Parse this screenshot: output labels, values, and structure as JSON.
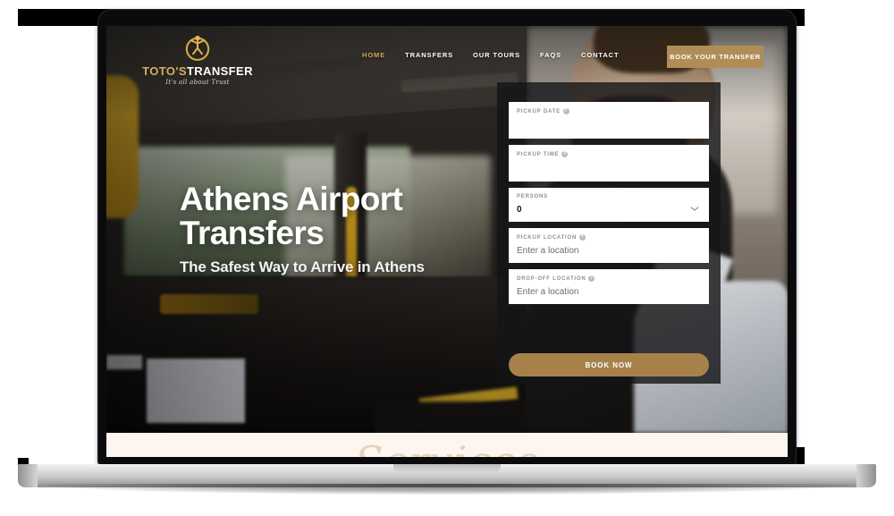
{
  "site": {
    "brand": {
      "name_part1": "TOTO'S",
      "name_part2": "TRANSFER",
      "tagline": "It's all about Trust",
      "logo_icon": "person-in-circle-gold-icon"
    },
    "nav": {
      "items": [
        {
          "label": "HOME",
          "active": true
        },
        {
          "label": "TRANSFERS",
          "active": false
        },
        {
          "label": "OUR TOURS",
          "active": false
        },
        {
          "label": "FAQS",
          "active": false
        },
        {
          "label": "CONTACT",
          "active": false
        }
      ],
      "cta_label": "BOOK YOUR TRANSFER"
    },
    "hero": {
      "title_line1": "Athens Airport",
      "title_line2": "Transfers",
      "subtitle": "The Safest Way to Arrive in Athens"
    },
    "booking_form": {
      "fields": [
        {
          "label": "PICKUP DATE",
          "help": "?",
          "value": ""
        },
        {
          "label": "PICKUP TIME",
          "help": "?",
          "value": ""
        },
        {
          "label": "PERSONS",
          "help": "",
          "value": "0",
          "control": "chevron-down-icon"
        },
        {
          "label": "PICKUP LOCATION",
          "help": "?",
          "value": "Enter a location"
        },
        {
          "label": "DROP-OFF LOCATION",
          "help": "?",
          "value": "Enter a location"
        }
      ],
      "submit_label": "BOOK NOW"
    },
    "services_section": {
      "title": "Services"
    },
    "colors": {
      "gold": "#b08d57",
      "gold_button": "#a6824a",
      "nav_active": "#d6a95a",
      "panel_bg": "rgba(20,20,22,0.80)",
      "cream": "#fdf5ee"
    }
  },
  "device": {
    "type": "laptop-mockup"
  }
}
